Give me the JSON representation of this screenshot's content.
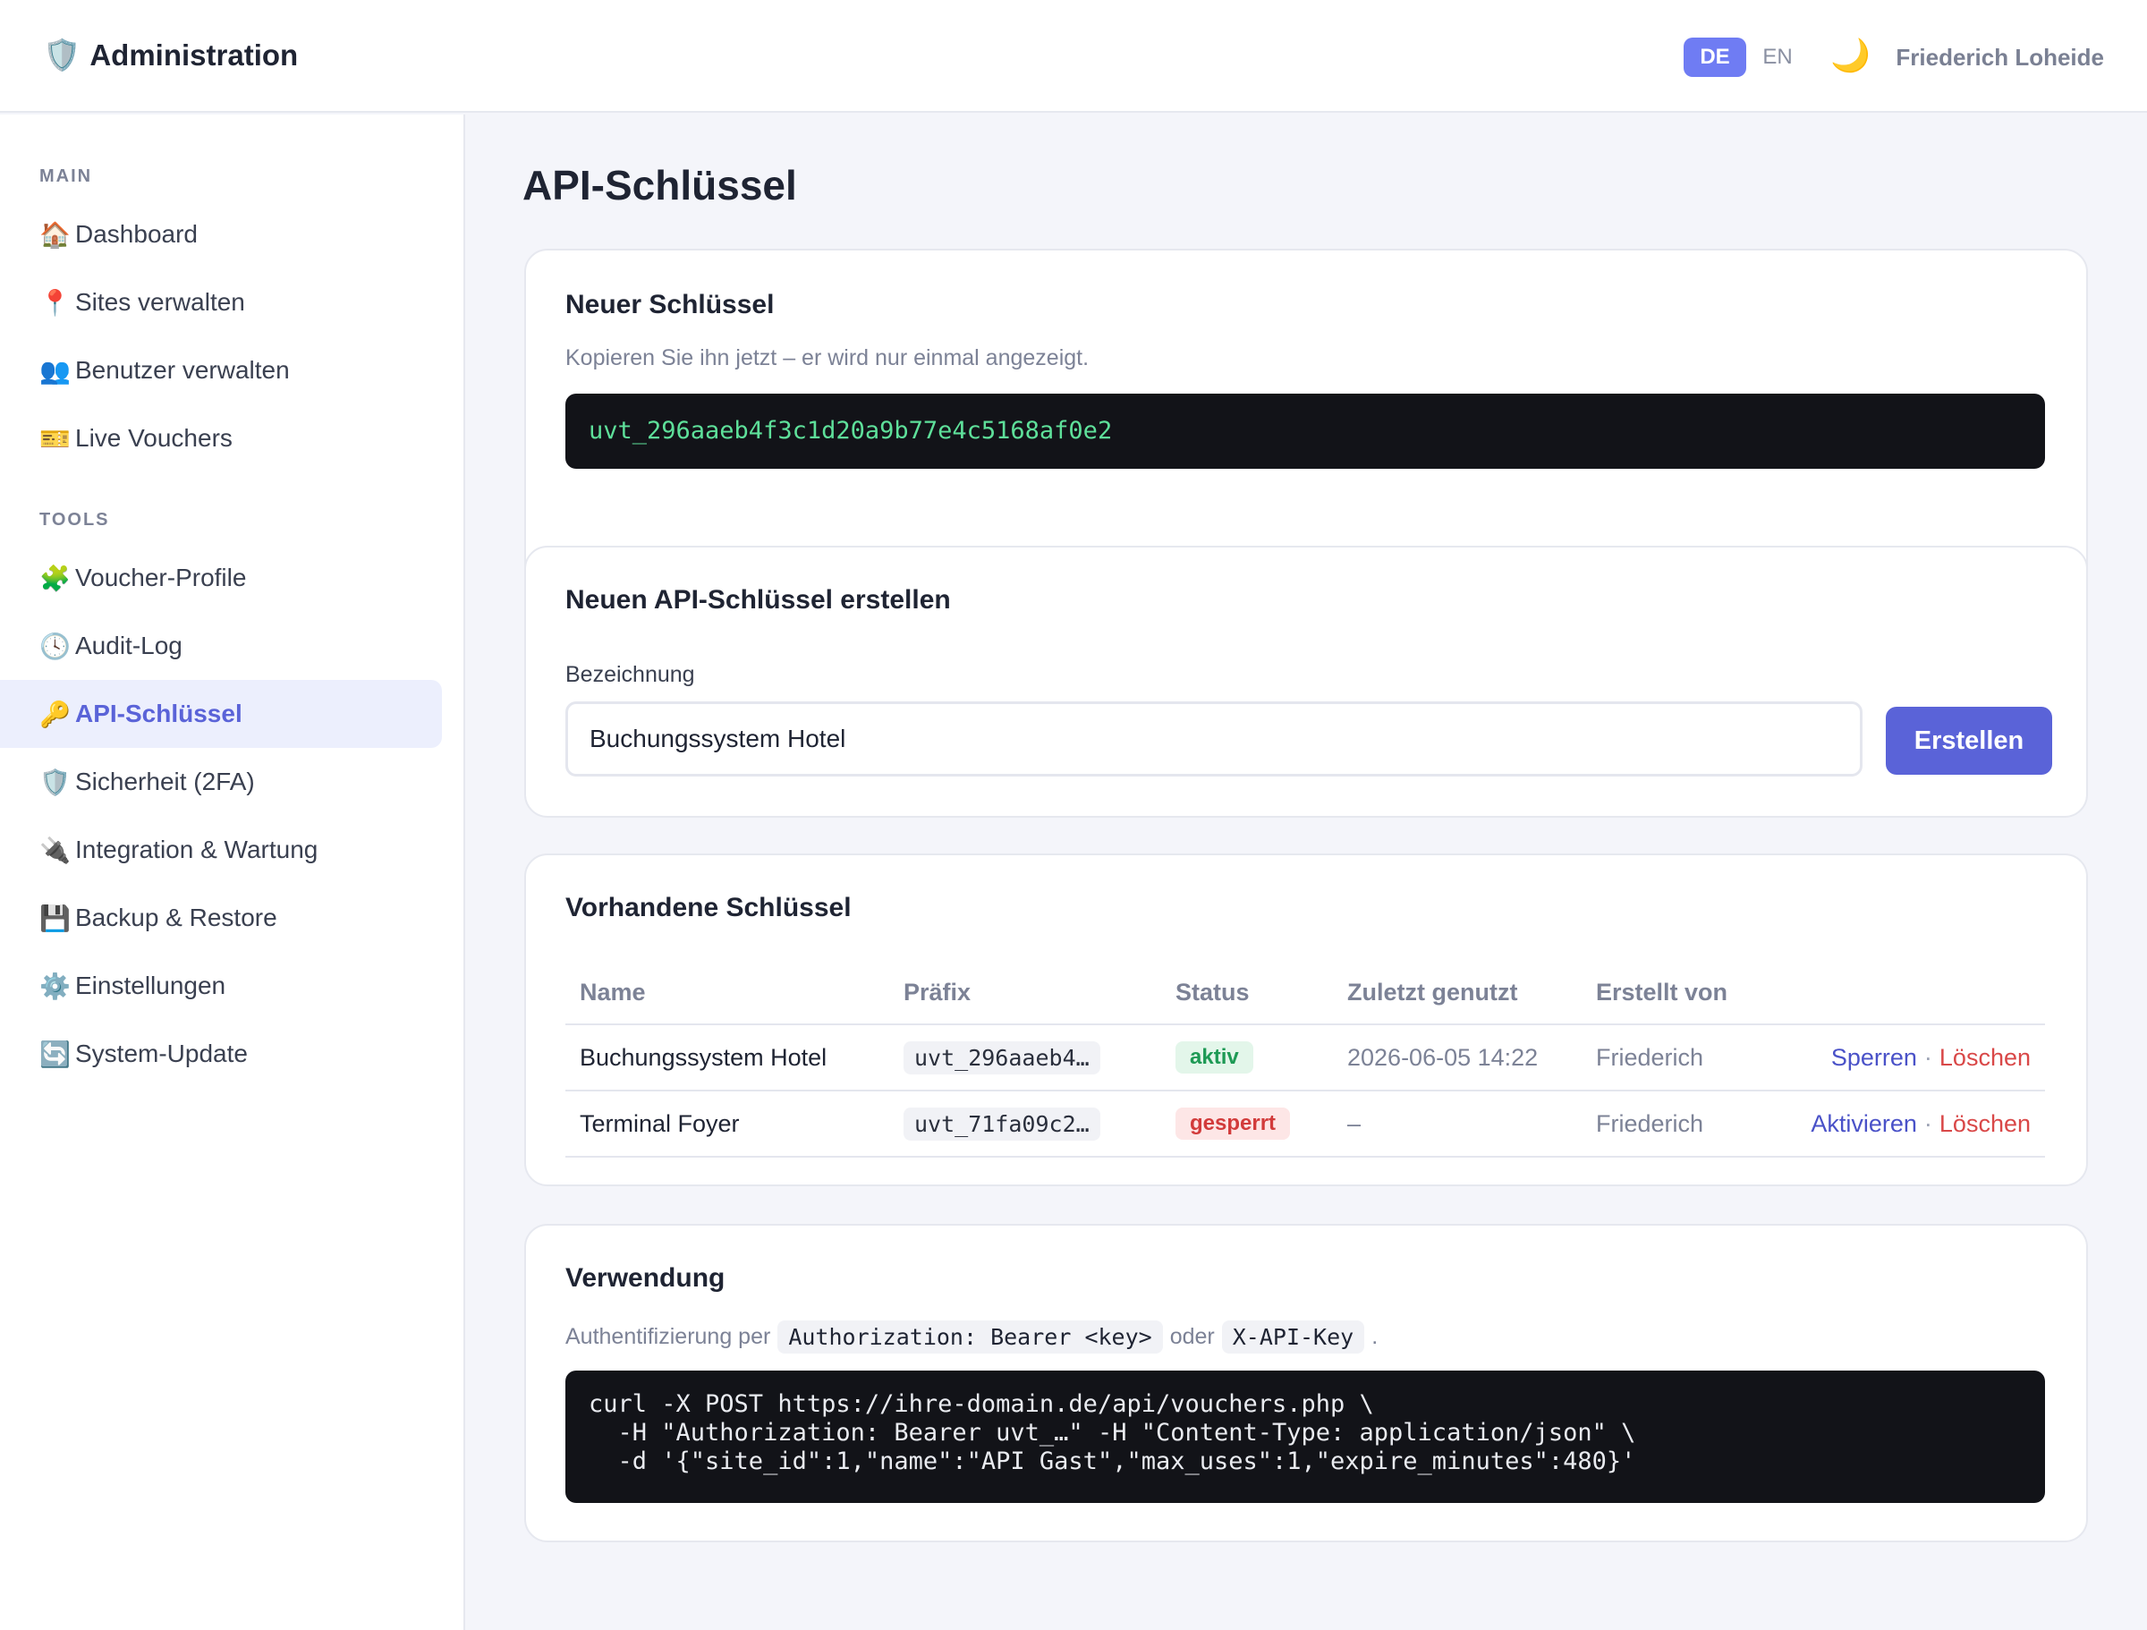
{
  "header": {
    "brand_icon": "shield-icon",
    "title": "Administration",
    "lang_de": "DE",
    "lang_en": "EN",
    "theme_icon": "moon-icon",
    "user_name": "Friederich Loheide"
  },
  "sidebar": {
    "section_main": "MAIN",
    "section_tools": "TOOLS",
    "items": [
      {
        "label": "Dashboard",
        "icon": "🏠"
      },
      {
        "label": "Sites verwalten",
        "icon": "📍"
      },
      {
        "label": "Benutzer verwalten",
        "icon": "👥"
      },
      {
        "label": "Live Vouchers",
        "icon": "🎫"
      },
      {
        "label": "Voucher-Profile",
        "icon": "🧩"
      },
      {
        "label": "Audit-Log",
        "icon": "🕓"
      },
      {
        "label": "API-Schlüssel",
        "icon": "🔑"
      },
      {
        "label": "Sicherheit (2FA)",
        "icon": "🛡️"
      },
      {
        "label": "Integration & Wartung",
        "icon": "🔌"
      },
      {
        "label": "Backup & Restore",
        "icon": "💾"
      },
      {
        "label": "Einstellungen",
        "icon": "⚙️"
      },
      {
        "label": "System-Update",
        "icon": "🔄"
      }
    ],
    "active_item": "API-Schlüssel"
  },
  "page": {
    "title": "API-Schlüssel"
  },
  "new_key": {
    "title": "Neuer Schlüssel",
    "hint": "Kopieren Sie ihn jetzt – er wird nur einmal angezeigt.",
    "value": "uvt_296aaeb4f3c1d20a9b77e4c5168af0e2"
  },
  "create": {
    "title": "Neuen API-Schlüssel erstellen",
    "label": "Bezeichnung",
    "input_value": "Buchungssystem Hotel",
    "button": "Erstellen"
  },
  "existing": {
    "title": "Vorhandene Schlüssel",
    "columns": [
      "Name",
      "Präfix",
      "Status",
      "Zuletzt genutzt",
      "Erstellt von"
    ],
    "rows": [
      {
        "name": "Buchungssystem Hotel",
        "prefix": "uvt_296aaeb4…",
        "status": "aktiv",
        "last_used": "2026-06-05 14:22",
        "created_by": "Friederich",
        "action_primary": "Sperren",
        "separator": "·",
        "action_delete": "Löschen"
      },
      {
        "name": "Terminal Foyer",
        "prefix": "uvt_71fa09c2…",
        "status": "gesperrt",
        "last_used": "–",
        "created_by": "Friederich",
        "action_primary": "Aktivieren",
        "separator": "·",
        "action_delete": "Löschen"
      }
    ],
    "colors": {
      "active": "#1e9a55",
      "blocked": "#d23b3b"
    }
  },
  "usage": {
    "title": "Verwendung",
    "text_prefix": "Authentifizierung per",
    "code_auth": "Authorization: Bearer <key>",
    "text_or": "oder",
    "code_header": "X-API-Key",
    "text_end": ".",
    "code": "curl -X POST https://ihre-domain.de/api/vouchers.php \\\n  -H \"Authorization: Bearer uvt_…\" -H \"Content-Type: application/json\" \\\n  -d '{\"site_id\":1,\"name\":\"API Gast\",\"max_uses\":1,\"expire_minutes\":480}'"
  },
  "colors": {
    "accent": "#5a63d8",
    "code_bg": "#121318",
    "key_green": "#5ee09a"
  }
}
